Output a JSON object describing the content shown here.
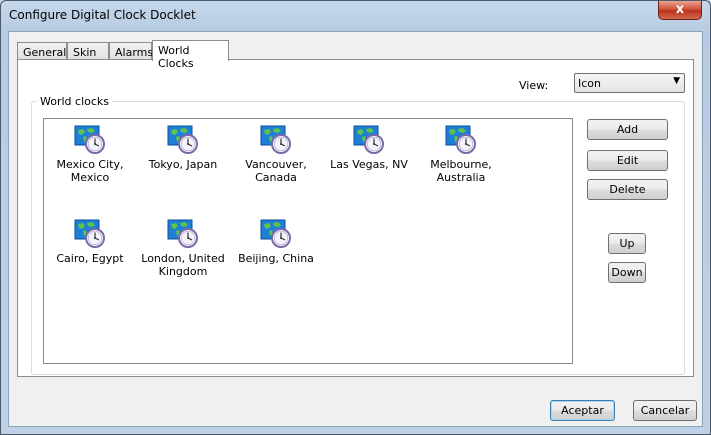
{
  "window": {
    "title": "Configure Digital Clock Docklet",
    "close_label": "x"
  },
  "tabs": [
    {
      "label": "General"
    },
    {
      "label": "Skin"
    },
    {
      "label": "Alarms"
    },
    {
      "label": "World Clocks"
    }
  ],
  "view": {
    "label": "View:",
    "selected": "Icon"
  },
  "group": {
    "label": "World clocks"
  },
  "clocks": [
    {
      "name": "Mexico City, Mexico"
    },
    {
      "name": "Tokyo, Japan"
    },
    {
      "name": "Vancouver, Canada"
    },
    {
      "name": "Las Vegas, NV"
    },
    {
      "name": "Melbourne, Australia"
    },
    {
      "name": "Cairo, Egypt"
    },
    {
      "name": "London, United Kingdom"
    },
    {
      "name": "Beijing, China"
    }
  ],
  "buttons": {
    "add": "Add",
    "edit": "Edit",
    "delete": "Delete",
    "up": "Up",
    "down": "Down",
    "ok": "Aceptar",
    "cancel": "Cancelar"
  },
  "colors": {
    "titlebar": "#c5d8ec",
    "close": "#c7432b",
    "dialog": "#f0f0f0",
    "default_border": "#3c7fb1"
  }
}
